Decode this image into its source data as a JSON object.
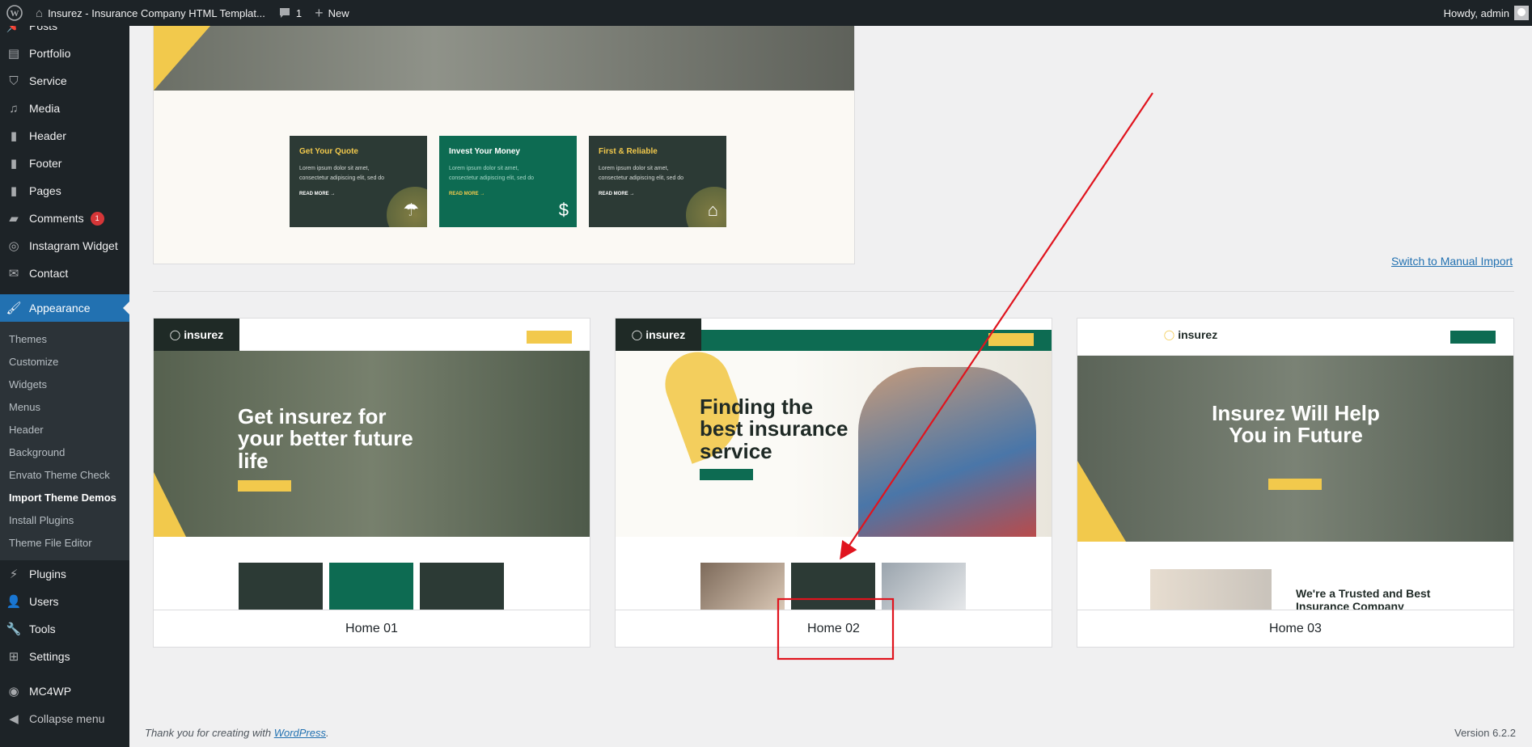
{
  "adminbar": {
    "site_title": "Insurez - Insurance Company HTML Templat...",
    "comments_count": "1",
    "new_label": "New",
    "howdy": "Howdy, admin"
  },
  "sidebar": {
    "items_top": [
      {
        "label": "Posts",
        "icon": "pin-icon"
      },
      {
        "label": "Portfolio",
        "icon": "portfolio-icon"
      },
      {
        "label": "Service",
        "icon": "shield-icon"
      },
      {
        "label": "Media",
        "icon": "media-icon"
      },
      {
        "label": "Header",
        "icon": "page-icon"
      },
      {
        "label": "Footer",
        "icon": "page-icon"
      },
      {
        "label": "Pages",
        "icon": "page-icon"
      },
      {
        "label": "Comments",
        "icon": "comment-icon",
        "badge": "1"
      },
      {
        "label": "Instagram Widget",
        "icon": "instagram-icon"
      },
      {
        "label": "Contact",
        "icon": "mail-icon"
      }
    ],
    "appearance": "Appearance",
    "submenu": [
      "Themes",
      "Customize",
      "Widgets",
      "Menus",
      "Header",
      "Background",
      "Envato Theme Check",
      "Import Theme Demos",
      "Install Plugins",
      "Theme File Editor"
    ],
    "items_bottom": [
      {
        "label": "Plugins",
        "icon": "plugin-icon"
      },
      {
        "label": "Users",
        "icon": "users-icon"
      },
      {
        "label": "Tools",
        "icon": "tools-icon"
      },
      {
        "label": "Settings",
        "icon": "settings-icon"
      }
    ],
    "mc4wp": "MC4WP",
    "collapse": "Collapse menu"
  },
  "preview_top": {
    "cards": [
      {
        "title": "Get Your Quote",
        "text": "Lorem ipsum dolor sit amet, consectetur adipiscing elit, sed do",
        "more": "READ MORE →"
      },
      {
        "title": "Invest Your Money",
        "text": "Lorem ipsum dolor sit amet, consectetur adipiscing elit, sed do",
        "more": "READ MORE →"
      },
      {
        "title": "First & Reliable",
        "text": "Lorem ipsum dolor sit amet, consectetur adipiscing elit, sed do",
        "more": "READ MORE →"
      }
    ]
  },
  "manual_import": "Switch to Manual Import",
  "demos": [
    {
      "name": "Home 01",
      "logo": "insurez",
      "hero": "Get insurez for your better future life"
    },
    {
      "name": "Home 02",
      "logo": "insurez",
      "hero": "Finding the best insurance service"
    },
    {
      "name": "Home 03",
      "logo": "insurez",
      "hero": "Insurez Will Help You in Future",
      "sub": "We're a Trusted and Best Insurance Company"
    }
  ],
  "footer": {
    "thanks_prefix": "Thank you for creating with ",
    "wp_link": "WordPress",
    "thanks_suffix": ".",
    "version": "Version 6.2.2"
  },
  "colors": {
    "admin_dark": "#1d2327",
    "accent": "#2271b1",
    "annotation_red": "#e0141e",
    "brand_yellow": "#f2c94c",
    "brand_green": "#0d6b52"
  }
}
